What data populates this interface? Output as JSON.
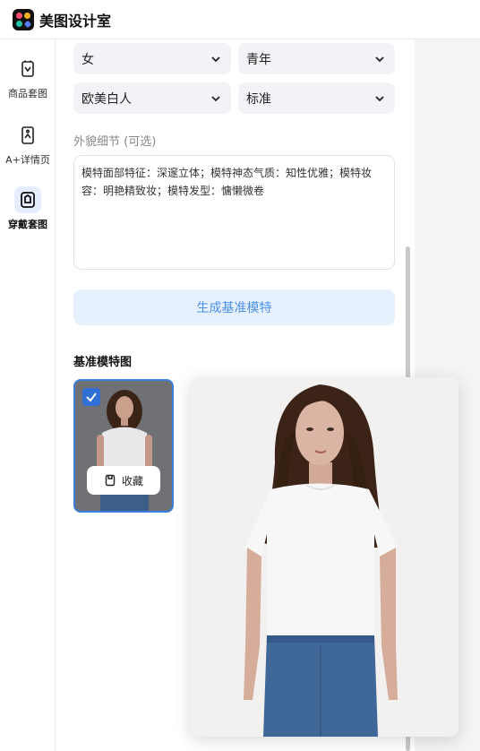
{
  "app": {
    "title": "美图设计室"
  },
  "sidebar": {
    "items": [
      {
        "label": "商品套图",
        "icon": "product-set-icon",
        "active": false
      },
      {
        "label": "A+详情页",
        "icon": "detail-page-icon",
        "active": false
      },
      {
        "label": "穿戴套图",
        "icon": "wear-set-icon",
        "active": true
      }
    ]
  },
  "form": {
    "gender": "女",
    "age": "青年",
    "ethnicity": "欧美白人",
    "body": "标准",
    "appearance_label": "外貌细节 (可选)",
    "appearance_value": "模特面部特征：深邃立体；模特神态气质：知性优雅；模特妆容：明艳精致妆；模特发型：慵懒微卷",
    "generate_button": "生成基准模特"
  },
  "results": {
    "title": "基准模特图",
    "favorite_button": "收藏"
  },
  "colors": {
    "accent": "#3d7fe0",
    "button_bg": "#e7f1fd",
    "button_text": "#4a8fe8",
    "active_bg": "#e5edff"
  }
}
